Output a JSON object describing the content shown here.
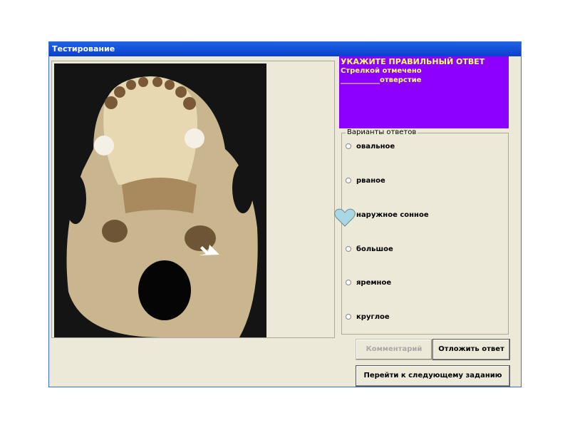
{
  "window": {
    "title": "Тестирование"
  },
  "question": {
    "line1": "УКАЖИТЕ ПРАВИЛЬНЫЙ ОТВЕТ",
    "line2": "Стрелкой отмечено",
    "line3": "___________отверстие"
  },
  "answers": {
    "legend": "Варианты ответов",
    "options": [
      "овальное",
      "рваное",
      "наружное сонное",
      "большое",
      "яремное",
      "круглое"
    ]
  },
  "buttons": {
    "comment": "Комментарий",
    "postpone": "Отложить ответ",
    "next": "Перейти к следующему заданию"
  }
}
